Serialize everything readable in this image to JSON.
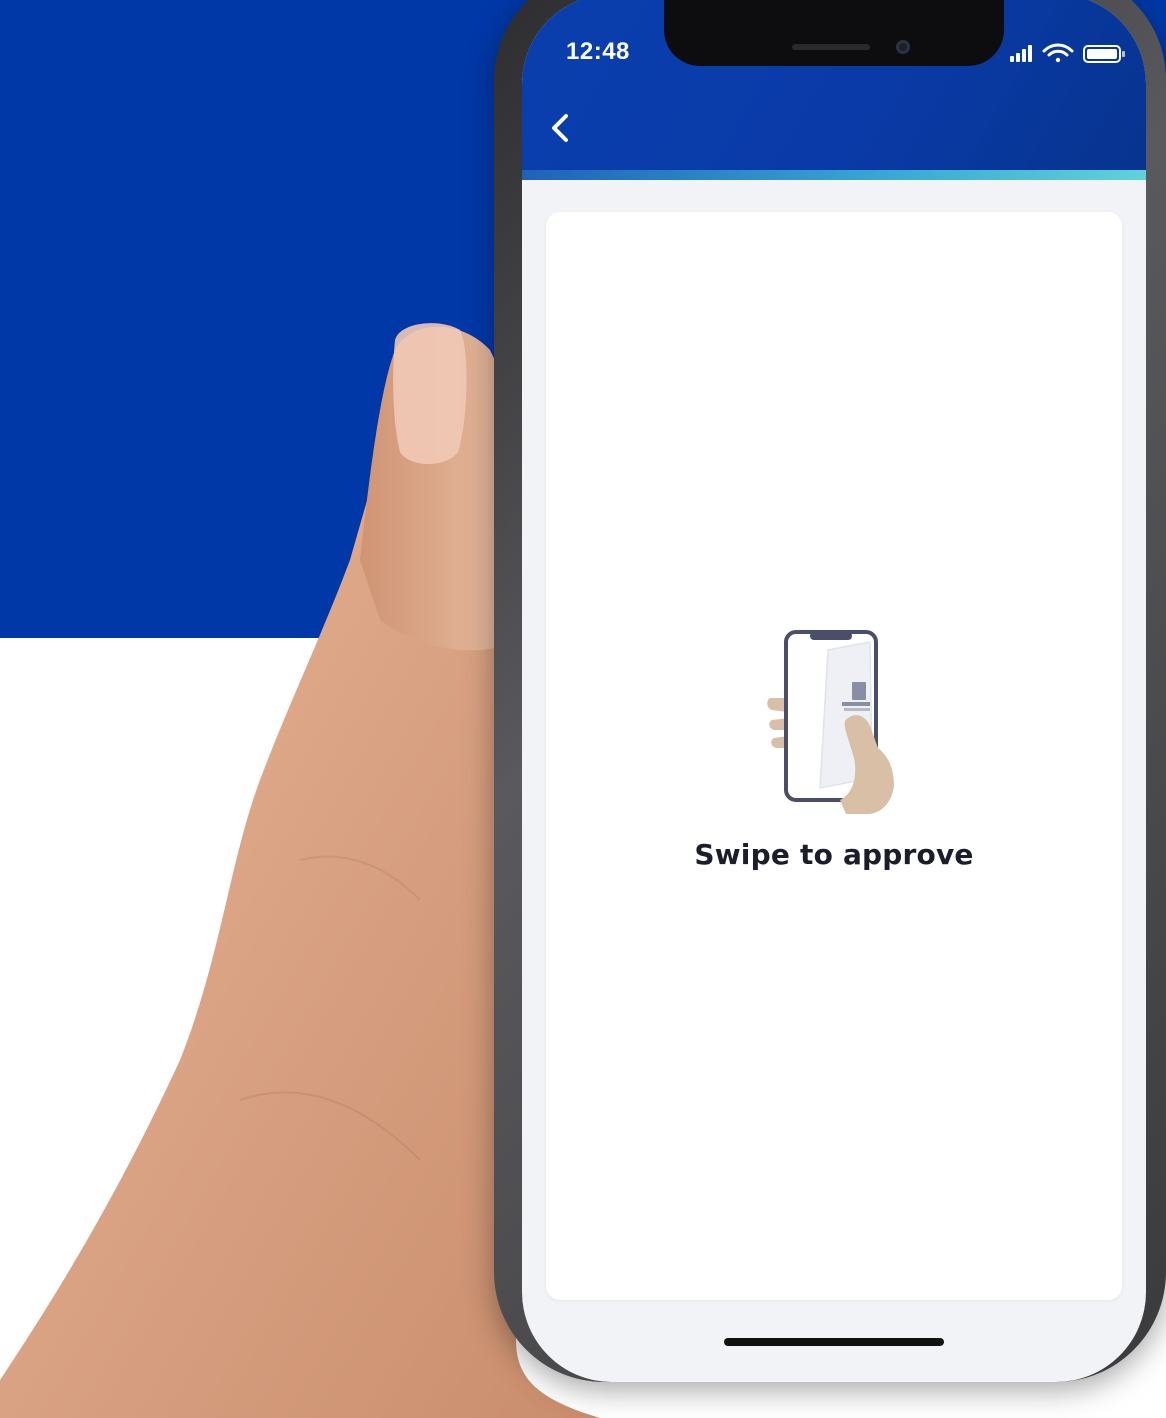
{
  "status_bar": {
    "time": "12:48",
    "signal_icon": "cellular-signal-icon",
    "wifi_icon": "wifi-icon",
    "battery_icon": "battery-icon"
  },
  "header": {
    "back_icon": "chevron-left-icon",
    "background_color": "#0a3fae",
    "accent_color": "#3aa9d4"
  },
  "main": {
    "illustration_icon": "hand-holding-phone-icon",
    "swipe_label": "Swipe to approve"
  },
  "colors": {
    "brand_blue": "#0038a8",
    "text_dark": "#1b1d2a",
    "card_background": "#ffffff",
    "screen_background": "#f2f3f6"
  }
}
